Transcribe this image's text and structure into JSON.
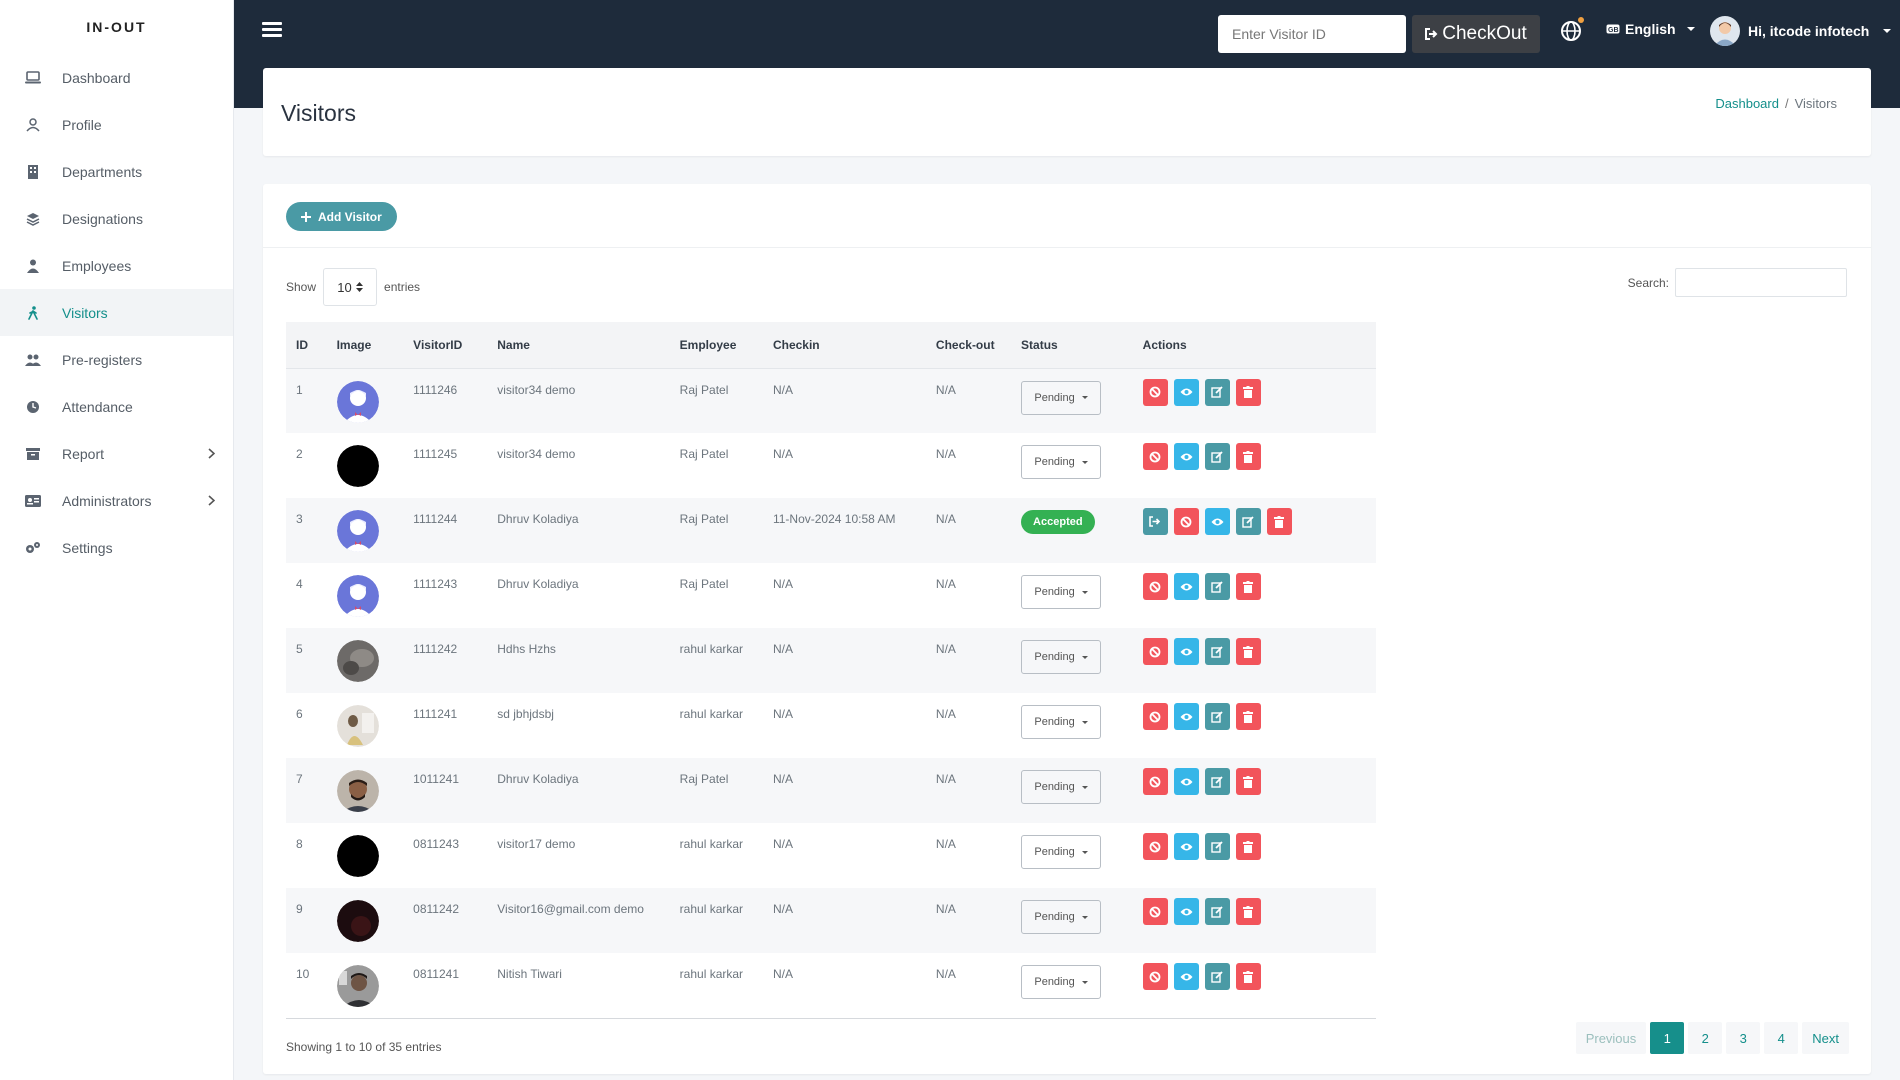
{
  "brand": "IN-OUT",
  "sidebar": {
    "items": [
      {
        "label": "Dashboard",
        "icon": "laptop-icon",
        "active": false
      },
      {
        "label": "Profile",
        "icon": "user-icon",
        "active": false
      },
      {
        "label": "Departments",
        "icon": "building-icon",
        "active": false
      },
      {
        "label": "Designations",
        "icon": "layers-icon",
        "active": false
      },
      {
        "label": "Employees",
        "icon": "employee-icon",
        "active": false
      },
      {
        "label": "Visitors",
        "icon": "walking-icon",
        "active": true
      },
      {
        "label": "Pre-registers",
        "icon": "users-icon",
        "active": false
      },
      {
        "label": "Attendance",
        "icon": "clock-icon",
        "active": false
      },
      {
        "label": "Report",
        "icon": "archive-icon",
        "active": false,
        "expandable": true
      },
      {
        "label": "Administrators",
        "icon": "id-card-icon",
        "active": false,
        "expandable": true
      },
      {
        "label": "Settings",
        "icon": "gears-icon",
        "active": false
      }
    ]
  },
  "topbar": {
    "visitor_placeholder": "Enter Visitor ID",
    "checkout_label": "CheckOut",
    "language": "English",
    "user_greeting": "Hi, itcode infotech"
  },
  "header": {
    "title": "Visitors",
    "breadcrumb_home": "Dashboard",
    "breadcrumb_current": "Visitors"
  },
  "toolbar": {
    "add_label": "Add Visitor",
    "show_label": "Show",
    "entries_value": "10",
    "entries_label": "entries",
    "search_label": "Search:"
  },
  "table": {
    "columns": [
      "ID",
      "Image",
      "VisitorID",
      "Name",
      "Employee",
      "Checkin",
      "Check-out",
      "Status",
      "Actions"
    ],
    "rows": [
      {
        "id": "1",
        "avatar": "default",
        "visitor_id": "1111246",
        "name": "visitor34 demo",
        "employee": "Raj Patel",
        "checkin": "N/A",
        "checkout": "N/A",
        "status": "Pending"
      },
      {
        "id": "2",
        "avatar": "black",
        "visitor_id": "1111245",
        "name": "visitor34 demo",
        "employee": "Raj Patel",
        "checkin": "N/A",
        "checkout": "N/A",
        "status": "Pending"
      },
      {
        "id": "3",
        "avatar": "default",
        "visitor_id": "1111244",
        "name": "Dhruv Koladiya",
        "employee": "Raj Patel",
        "checkin": "11-Nov-2024 10:58 AM",
        "checkout": "N/A",
        "status": "Accepted"
      },
      {
        "id": "4",
        "avatar": "default",
        "visitor_id": "1111243",
        "name": "Dhruv Koladiya",
        "employee": "Raj Patel",
        "checkin": "N/A",
        "checkout": "N/A",
        "status": "Pending"
      },
      {
        "id": "5",
        "avatar": "gray",
        "visitor_id": "1111242",
        "name": "Hdhs Hzhs",
        "employee": "rahul karkar",
        "checkin": "N/A",
        "checkout": "N/A",
        "status": "Pending"
      },
      {
        "id": "6",
        "avatar": "light",
        "visitor_id": "1111241",
        "name": "sd jbhjdsbj",
        "employee": "rahul karkar",
        "checkin": "N/A",
        "checkout": "N/A",
        "status": "Pending"
      },
      {
        "id": "7",
        "avatar": "photo",
        "visitor_id": "1011241",
        "name": "Dhruv Koladiya",
        "employee": "Raj Patel",
        "checkin": "N/A",
        "checkout": "N/A",
        "status": "Pending"
      },
      {
        "id": "8",
        "avatar": "black",
        "visitor_id": "0811243",
        "name": "visitor17 demo",
        "employee": "rahul karkar",
        "checkin": "N/A",
        "checkout": "N/A",
        "status": "Pending"
      },
      {
        "id": "9",
        "avatar": "dark",
        "visitor_id": "0811242",
        "name": "Visitor16@gmail.com demo",
        "employee": "rahul karkar",
        "checkin": "N/A",
        "checkout": "N/A",
        "status": "Pending"
      },
      {
        "id": "10",
        "avatar": "photo2",
        "visitor_id": "0811241",
        "name": "Nitish Tiwari",
        "employee": "rahul karkar",
        "checkin": "N/A",
        "checkout": "N/A",
        "status": "Pending"
      }
    ]
  },
  "footer": {
    "info": "Showing 1 to 10 of 35 entries",
    "pages": [
      "Previous",
      "1",
      "2",
      "3",
      "4",
      "Next"
    ],
    "active_page": "1"
  },
  "colors": {
    "accent": "#148f8b",
    "topbar": "#1e2b3b",
    "danger": "#f2545b",
    "info": "#36b6e8",
    "primary": "#4a9aa5",
    "success": "#34b153"
  }
}
